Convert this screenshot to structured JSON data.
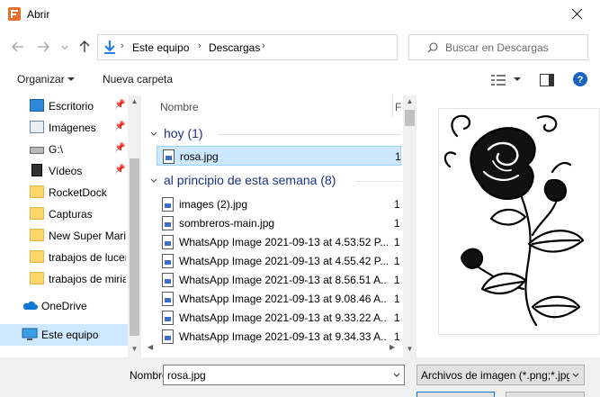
{
  "window": {
    "title": "Abrir"
  },
  "address": {
    "segments": [
      "Este equipo",
      "Descargas"
    ]
  },
  "search": {
    "placeholder": "Buscar en Descargas"
  },
  "toolbar": {
    "organize_label": "Organizar",
    "new_folder_label": "Nueva carpeta"
  },
  "sidebar": {
    "items": [
      {
        "label": "Escritorio",
        "icon": "desktop-icon",
        "pinned": true
      },
      {
        "label": "Imágenes",
        "icon": "pictures-icon",
        "pinned": true
      },
      {
        "label": "G:\\",
        "icon": "drive-icon",
        "pinned": true
      },
      {
        "label": "Vídeos",
        "icon": "videos-icon",
        "pinned": true
      },
      {
        "label": "RocketDock",
        "icon": "folder-icon",
        "pinned": false
      },
      {
        "label": "Capturas",
        "icon": "folder-icon",
        "pinned": false
      },
      {
        "label": "New Super Mario",
        "icon": "folder-icon",
        "pinned": false
      },
      {
        "label": "trabajos de lucero",
        "icon": "folder-icon",
        "pinned": false
      },
      {
        "label": "trabajos de miriam",
        "icon": "folder-icon",
        "pinned": false
      },
      {
        "label": "OneDrive",
        "icon": "onedrive-icon",
        "pinned": false
      },
      {
        "label": "Este equipo",
        "icon": "computer-icon",
        "pinned": false
      }
    ]
  },
  "filelist": {
    "columns": [
      "Nombre",
      "F"
    ],
    "groups": [
      {
        "title": "hoy (1)",
        "files": [
          "rosa.jpg"
        ]
      },
      {
        "title": "al principio de esta semana (8)",
        "files": [
          "images (2).jpg",
          "sombreros-main.jpg",
          "WhatsApp Image 2021-09-13 at 4.53.52 P...",
          "WhatsApp Image 2021-09-13 at 4.55.42 P...",
          "WhatsApp Image 2021-09-13 at 8.56.51 A...",
          "WhatsApp Image 2021-09-13 at 9.08.46 A...",
          "WhatsApp Image 2021-09-13 at 9.33.22 A...",
          "WhatsApp Image 2021-09-13 at 9.34.33 A..."
        ]
      }
    ],
    "date_col_prefix": "1",
    "selected_file": "rosa.jpg"
  },
  "bottom": {
    "name_label": "Nombre:",
    "name_value": "rosa.jpg",
    "filetype_value": "Archivos de imagen (*.png;*.jpg"
  },
  "colors": {
    "accent": "#0078d7",
    "selection": "#cce8ff",
    "group_header": "#1e3287"
  }
}
